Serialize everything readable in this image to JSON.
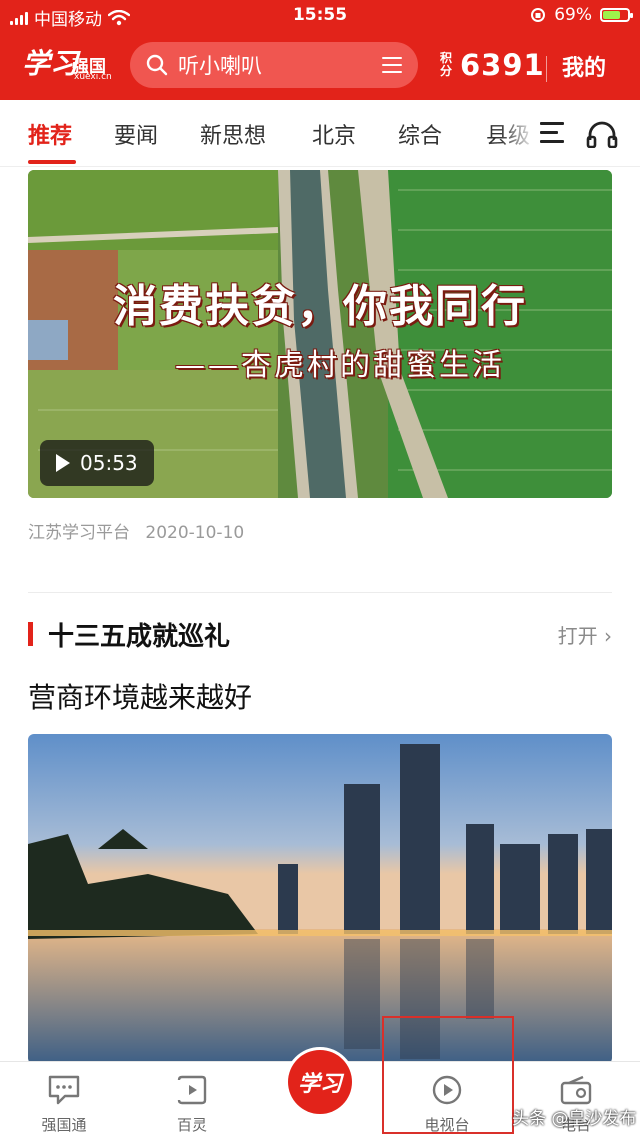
{
  "status_bar": {
    "carrier": "中国移动",
    "time": "15:55",
    "battery_pct": "69%",
    "battery_level": 0.69
  },
  "header": {
    "logo_script": "学习",
    "logo_name": "强国",
    "logo_domain": "xuexi.cn",
    "search_placeholder": "听小喇叭",
    "points_label": "积分",
    "points_value": "6391",
    "mine_label": "我的"
  },
  "tabs": [
    {
      "label": "推荐",
      "active": true
    },
    {
      "label": "要闻",
      "active": false
    },
    {
      "label": "新思想",
      "active": false
    },
    {
      "label": "北京",
      "active": false
    },
    {
      "label": "综合",
      "active": false
    },
    {
      "label": "县级",
      "active": false
    }
  ],
  "video_card": {
    "title": "消费扶贫，你我同行",
    "subtitle": "——杏虎村的甜蜜生活",
    "duration": "05:53",
    "source": "江苏学习平台",
    "date": "2020-10-10"
  },
  "section": {
    "title": "十三五成就巡礼",
    "open_label": "打开",
    "headline": "营商环境越来越好"
  },
  "bottom_nav": [
    {
      "label": "强国通",
      "icon": "chat-icon"
    },
    {
      "label": "百灵",
      "icon": "play-square-icon"
    },
    {
      "label": "学习",
      "icon": "xuexi-logo"
    },
    {
      "label": "电视台",
      "icon": "play-circle-icon"
    },
    {
      "label": "电台",
      "icon": "radio-icon"
    }
  ],
  "watermark": "头条 @皇沙发布",
  "colors": {
    "brand_red": "#e2231a",
    "search_bg": "#f05650",
    "text_gray": "#9a9a9a"
  }
}
